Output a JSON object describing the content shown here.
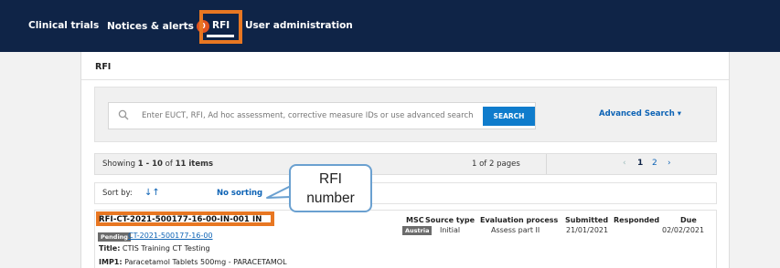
{
  "nav": {
    "items": [
      {
        "label": "Clinical trials"
      },
      {
        "label": "Notices & alerts",
        "badge": "0"
      },
      {
        "label": "RFI"
      },
      {
        "label": "User administration"
      }
    ],
    "active": "RFI"
  },
  "panel": {
    "title": "RFI"
  },
  "search": {
    "placeholder": "Enter EUCT, RFI, Ad hoc assessment, corrective measure IDs or use advanced search",
    "button_label": "SEARCH",
    "advanced_label": "Advanced Search ▾"
  },
  "pagination": {
    "showing_prefix": "Showing ",
    "showing_range": "1 - 10",
    "showing_of": " of ",
    "showing_total": "11 items",
    "page_of": "1 of 2 pages",
    "prev": "‹",
    "pages": [
      "1",
      "2"
    ],
    "next": "›"
  },
  "sort": {
    "label": "Sort by:",
    "icon": "↓↑",
    "value": "No sorting"
  },
  "result": {
    "rfi_id": "RFI-CT-2021-500177-16-00-IN-001 IN",
    "status": "Pending",
    "ct_link": "CT-2021-500177-16-00",
    "title_label": "Title:",
    "title_value": " CTIS Training CT Testing",
    "imp_label": "IMP1:",
    "imp_value": " Paracetamol Tablets 500mg - PARACETAMOL",
    "columns": {
      "msc": {
        "header": "MSC",
        "value": "Austria"
      },
      "source_type": {
        "header": "Source type",
        "value": "Initial"
      },
      "evaluation_process": {
        "header": "Evaluation process",
        "value": "Assess part II"
      },
      "submitted": {
        "header": "Submitted",
        "value": "21/01/2021"
      },
      "responded": {
        "header": "Responded",
        "value": ""
      },
      "due": {
        "header": "Due",
        "value": "02/02/2021"
      }
    }
  },
  "callout": {
    "line1": "RFI",
    "line2": "number"
  },
  "colors": {
    "nav_bg": "#0f2447",
    "highlight": "#e87722",
    "link": "#0d63b5",
    "button": "#0f7ccc",
    "badge": "#e2541f"
  }
}
